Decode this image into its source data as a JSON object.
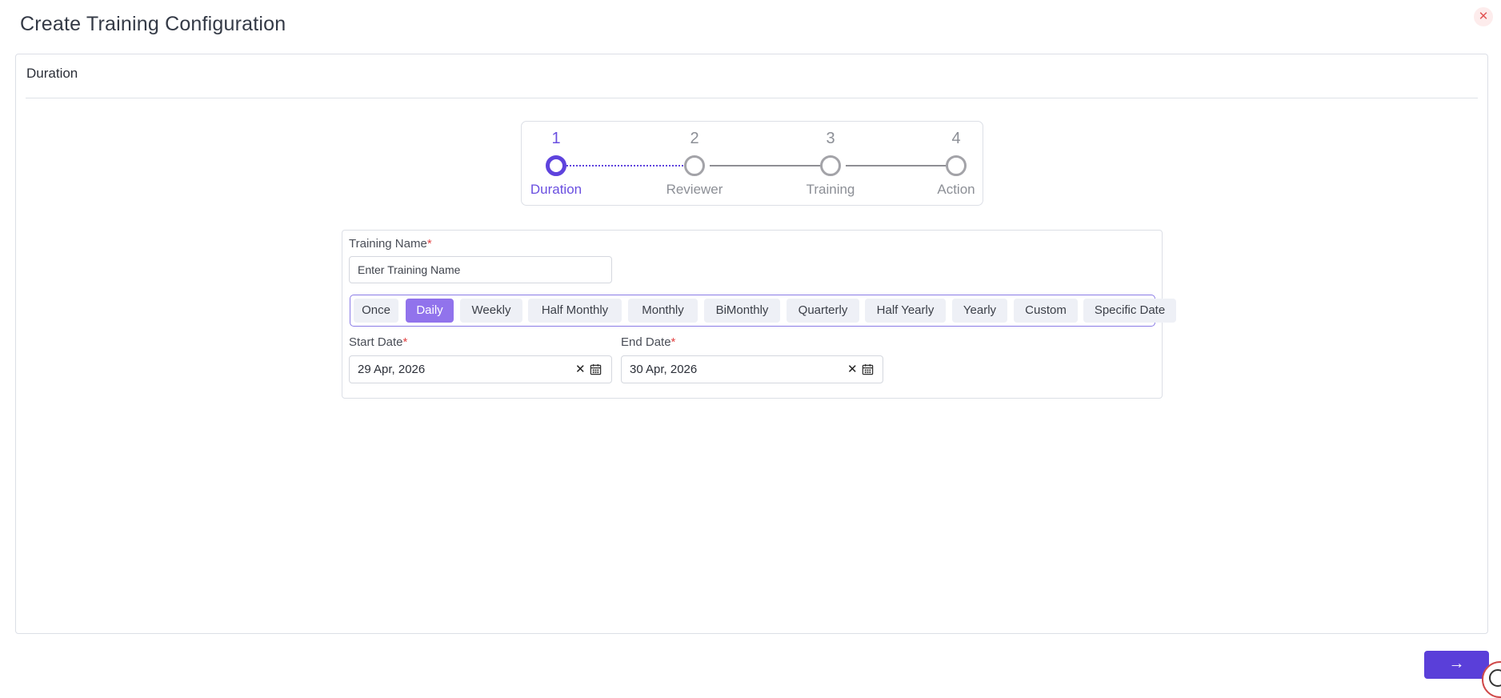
{
  "modal": {
    "title": "Create Training Configuration",
    "close_symbol": "✕",
    "next_symbol": "→"
  },
  "panel": {
    "title": "Duration"
  },
  "stepper": {
    "steps": [
      {
        "number": "1",
        "label": "Duration",
        "active": true
      },
      {
        "number": "2",
        "label": "Reviewer",
        "active": false
      },
      {
        "number": "3",
        "label": "Training",
        "active": false
      },
      {
        "number": "4",
        "label": "Action",
        "active": false
      }
    ]
  },
  "form": {
    "training_name": {
      "label": "Training Name",
      "required_mark": "*",
      "placeholder": "Enter Training Name",
      "value": ""
    },
    "frequency": {
      "options": [
        "Once",
        "Daily",
        "Weekly",
        "Half Monthly",
        "Monthly",
        "BiMonthly",
        "Quarterly",
        "Half Yearly",
        "Yearly",
        "Custom",
        "Specific Date"
      ],
      "selected": "Daily"
    },
    "start_date": {
      "label": "Start Date",
      "required_mark": "*",
      "value": "29 Apr, 2026",
      "clear_symbol": "✕"
    },
    "end_date": {
      "label": "End Date",
      "required_mark": "*",
      "value": "30 Apr, 2026",
      "clear_symbol": "✕"
    }
  },
  "colors": {
    "accent": "#5e43dd",
    "selected_tab": "#9173ec",
    "required": "#e24444"
  }
}
